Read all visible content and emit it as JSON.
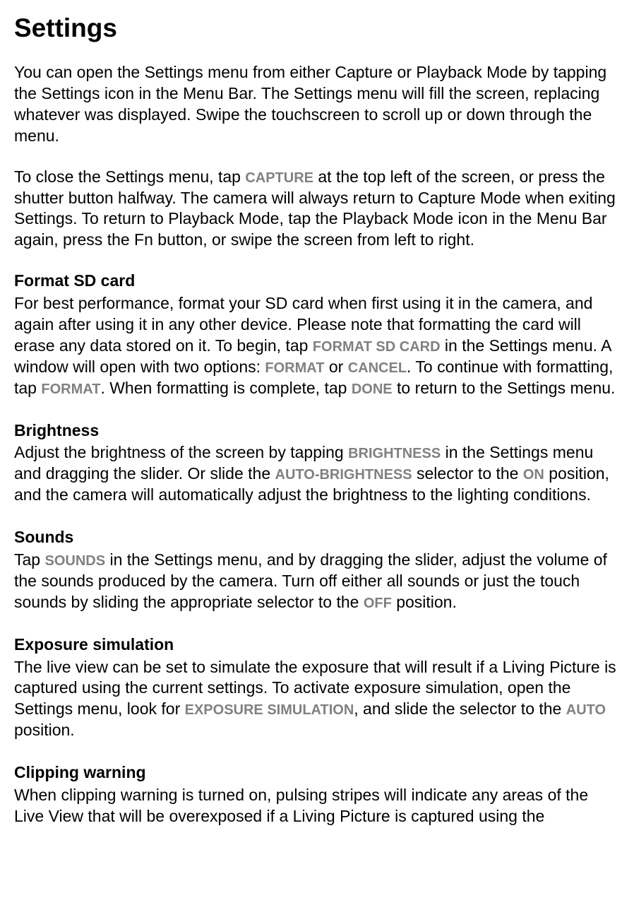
{
  "title": "Settings",
  "intro": {
    "p1_a": "You can open the Settings menu from either Capture or Playback Mode by tapping the Settings icon in the Menu Bar. The Settings menu will fill the screen, replacing whatever was displayed. Swipe the touchscreen to scroll up or down through the menu.",
    "p2_a": "To close the Settings menu, tap ",
    "p2_cap1": "CAPTURE",
    "p2_b": " at the top left of the screen, or press the shutter button halfway. The camera will always return to Capture Mode when exiting Settings. To return to Playback Mode, tap the Playback Mode icon in the Menu Bar again, press the Fn button, or swipe the screen from left to right."
  },
  "format": {
    "heading": "Format SD card",
    "a": "For best performance, format your SD card when first using it in the camera, and again after using it in any other device. Please note that formatting the card will erase any data stored on it. To begin, tap ",
    "cap1": "FORMAT SD CARD",
    "b": " in the Settings menu. A window will open with two options: ",
    "cap2": "FORMAT",
    "c": " or ",
    "cap3": "CANCEL",
    "d": ". To continue with formatting, tap ",
    "cap4": "FORMAT",
    "e": ". When formatting is complete, tap ",
    "cap5": "DONE",
    "f": " to return to the Settings menu."
  },
  "brightness": {
    "heading": "Brightness",
    "a": "Adjust the brightness of the screen by tapping ",
    "cap1": "BRIGHTNESS",
    "b": " in the Settings menu and dragging the slider. Or slide the ",
    "cap2": "AUTO-BRIGHTNESS",
    "c": " selector to the ",
    "cap3": "ON",
    "d": " position, and the camera will automatically adjust the brightness to the lighting conditions."
  },
  "sounds": {
    "heading": "Sounds",
    "a": "Tap ",
    "cap1": "SOUNDS",
    "b": " in the Settings menu, and by dragging the slider, adjust the volume of the sounds produced by the camera. Turn off either all sounds or just the touch sounds by sliding the appropriate selector to the ",
    "cap2": "OFF",
    "c": " position."
  },
  "exposure": {
    "heading": "Exposure simulation",
    "a": "The live view can be set to simulate the exposure that will result if a Living Picture is captured using the current settings. To activate exposure simulation, open the Settings menu, look for ",
    "cap1": "EXPOSURE SIMULATION",
    "b": ", and slide the selector to the ",
    "cap2": "AUTO",
    "c": " position."
  },
  "clipping": {
    "heading": "Clipping warning",
    "a": "When clipping warning is turned on, pulsing stripes will indicate any areas of the Live View that will be overexposed if a Living Picture is captured using the"
  }
}
